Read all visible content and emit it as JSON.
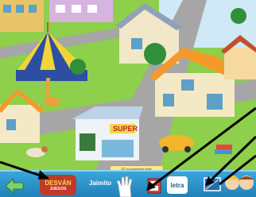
{
  "scene": {
    "awning_sign": "El supermercado",
    "shop_sign": "SUPER"
  },
  "toolbar": {
    "desvan_title": "DESVÁN",
    "desvan_subtitle": "JUEGOS",
    "character_name": "Jaimito",
    "caption": "El supermercado",
    "letter_button": "letra",
    "screen_badge": "0"
  },
  "icons": [
    "back-arrow-icon",
    "hand-icon",
    "book-icon",
    "screen-icon",
    "kids-characters-icon"
  ],
  "colors": {
    "toolbar": "#2b93c8",
    "grass": "#7fbf3a",
    "road": "#9a9a9a"
  }
}
